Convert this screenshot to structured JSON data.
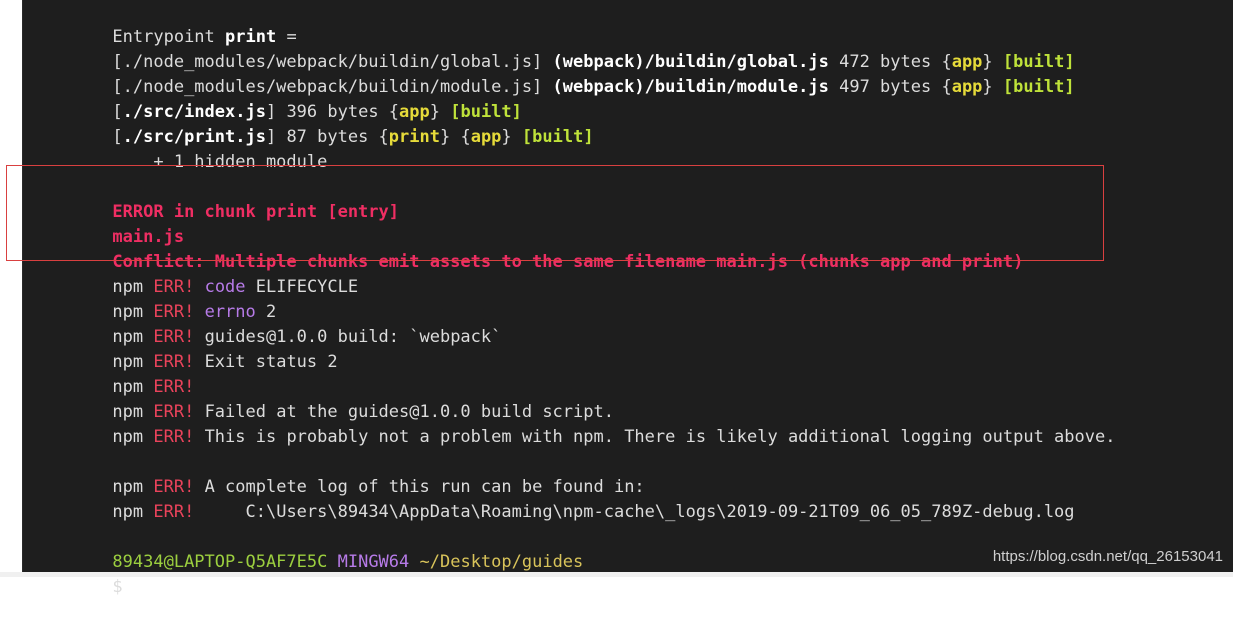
{
  "terminal": {
    "lines": [
      [
        "Entrypoint ",
        "print",
        " ="
      ],
      [
        "[./node_modules/webpack/buildin/global.js] ",
        "(webpack)/buildin/global.js",
        " 472 bytes {",
        "app",
        "} ",
        "[built]"
      ],
      [
        "[./node_modules/webpack/buildin/module.js] ",
        "(webpack)/buildin/module.js",
        " 497 bytes {",
        "app",
        "} ",
        "[built]"
      ],
      [
        "[",
        "./src/index.js",
        "] 396 bytes {",
        "app",
        "} ",
        "[built]"
      ],
      [
        "[",
        "./src/print.js",
        "] 87 bytes {",
        "print",
        "} {",
        "app",
        "} ",
        "[built]"
      ],
      [
        "    + 1 hidden module"
      ],
      [
        ""
      ],
      [
        "ERROR in chunk print [entry]"
      ],
      [
        "main.js"
      ],
      [
        "Conflict: Multiple chunks emit assets to the same filename main.js (chunks app and print)"
      ],
      [
        "npm ",
        "ERR!",
        " ",
        "code",
        " ELIFECYCLE"
      ],
      [
        "npm ",
        "ERR!",
        " ",
        "errno",
        " 2"
      ],
      [
        "npm ",
        "ERR!",
        " guides@1.0.0 build: `webpack`"
      ],
      [
        "npm ",
        "ERR!",
        " Exit status 2"
      ],
      [
        "npm ",
        "ERR!"
      ],
      [
        "npm ",
        "ERR!",
        " Failed at the guides@1.0.0 build script."
      ],
      [
        "npm ",
        "ERR!",
        " This is probably not a problem with npm. There is likely additional logging output above."
      ],
      [
        ""
      ],
      [
        "npm ",
        "ERR!",
        " A complete log of this run can be found in:"
      ],
      [
        "npm ",
        "ERR!",
        "     C:\\Users\\89434\\AppData\\Roaming\\npm-cache\\_logs\\2019-09-21T09_06_05_789Z-debug.log"
      ],
      [
        ""
      ],
      [
        "89434@LAPTOP-Q5AF7E5C",
        " ",
        "MINGW64",
        " ",
        "~/Desktop/guides"
      ],
      [
        "$"
      ]
    ]
  },
  "watermark": "https://blog.csdn.net/qq_26153041",
  "colors": {
    "background": "#1e1e1e",
    "text": "#dcdcdc",
    "error": "#ef2e63",
    "npm_err": "#e9435b",
    "keyword_yellow": "#e6db3a",
    "built_green": "#bfe23a",
    "purple": "#b77be8",
    "box_border": "#d94040"
  }
}
